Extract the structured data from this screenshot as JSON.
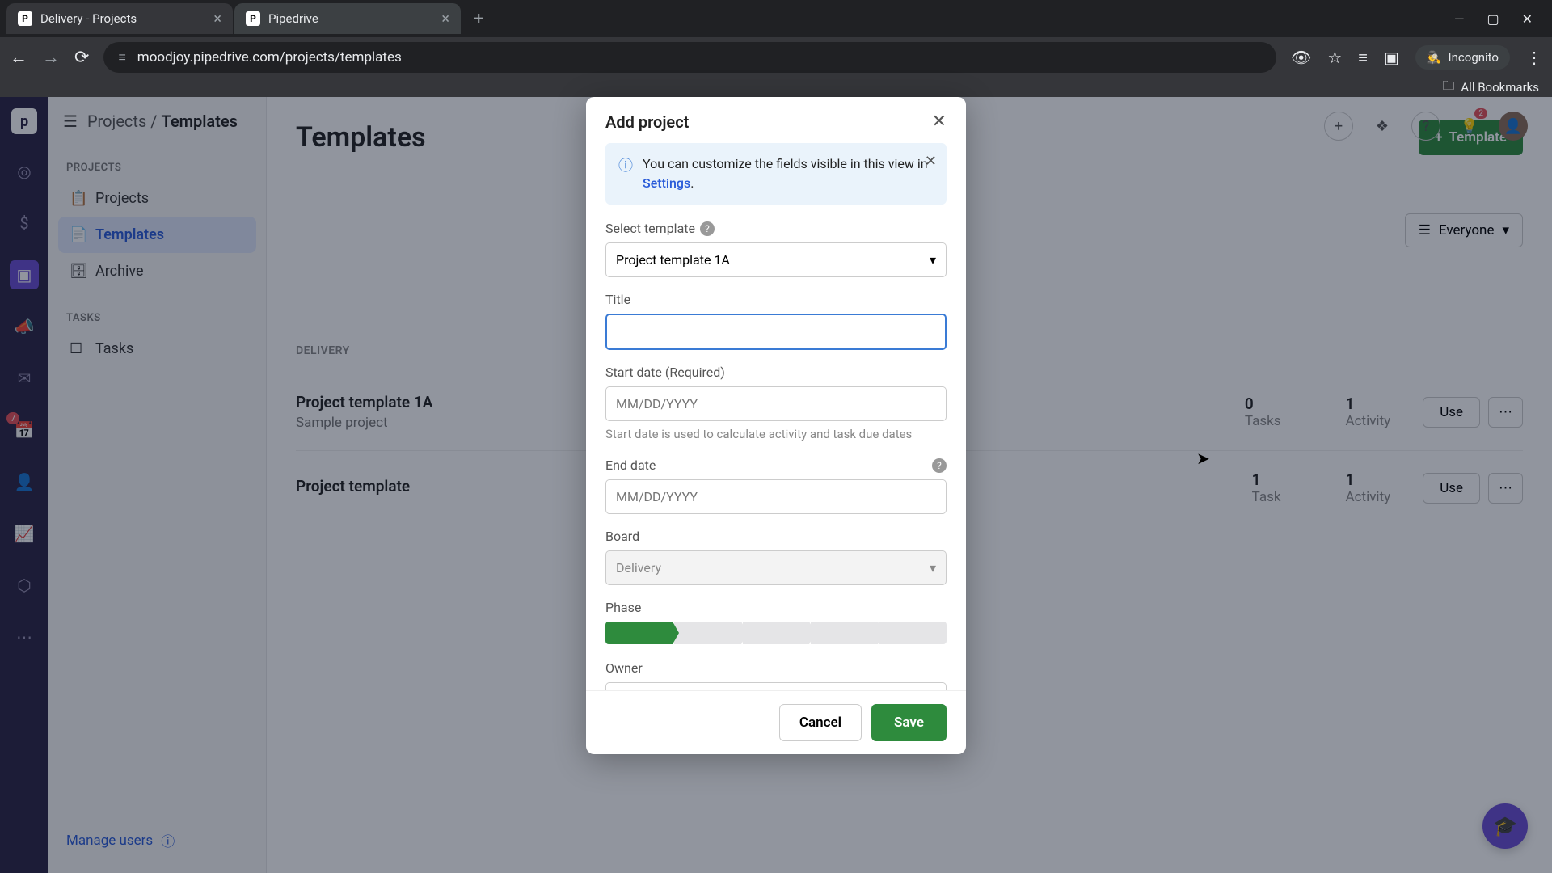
{
  "browser": {
    "tabs": [
      {
        "title": "Delivery - Projects",
        "favicon": "P"
      },
      {
        "title": "Pipedrive",
        "favicon": "P"
      }
    ],
    "url": "moodjoy.pipedrive.com/projects/templates",
    "incognito_label": "Incognito",
    "bookmarks_label": "All Bookmarks"
  },
  "rail": {
    "logo": "p",
    "badge": "7"
  },
  "sidebar": {
    "breadcrumb_root": "Projects",
    "breadcrumb_current": "Templates",
    "section_projects": "PROJECTS",
    "items_projects": [
      {
        "label": "Projects",
        "icon": "📋"
      },
      {
        "label": "Templates",
        "icon": "📄"
      },
      {
        "label": "Archive",
        "icon": "🗄"
      }
    ],
    "section_tasks": "TASKS",
    "items_tasks": [
      {
        "label": "Tasks",
        "icon": "☐"
      }
    ],
    "manage_users": "Manage users"
  },
  "main": {
    "title": "Templates",
    "template_button": "Template",
    "filter_label": "Everyone",
    "board_label": "DELIVERY",
    "rows": [
      {
        "name": "Project template 1A",
        "sub": "Sample project",
        "stat1_num": "0",
        "stat1_label": "Tasks",
        "stat2_num": "1",
        "stat2_label": "Activity",
        "use": "Use"
      },
      {
        "name": "Project template",
        "sub": "",
        "stat1_num": "1",
        "stat1_label": "Task",
        "stat2_num": "1",
        "stat2_label": "Activity",
        "use": "Use"
      }
    ]
  },
  "modal": {
    "title": "Add project",
    "banner_text_1": "You can customize the fields visible in this view in ",
    "banner_link": "Settings",
    "banner_dot": ".",
    "select_template_label": "Select template",
    "select_template_value": "Project template 1A",
    "title_label": "Title",
    "title_value": "",
    "start_date_label": "Start date (Required)",
    "start_date_placeholder": "MM/DD/YYYY",
    "start_date_hint": "Start date is used to calculate activity and task due dates",
    "end_date_label": "End date",
    "end_date_placeholder": "MM/DD/YYYY",
    "board_label": "Board",
    "board_value": "Delivery",
    "phase_label": "Phase",
    "owner_label": "Owner",
    "cancel": "Cancel",
    "save": "Save"
  }
}
